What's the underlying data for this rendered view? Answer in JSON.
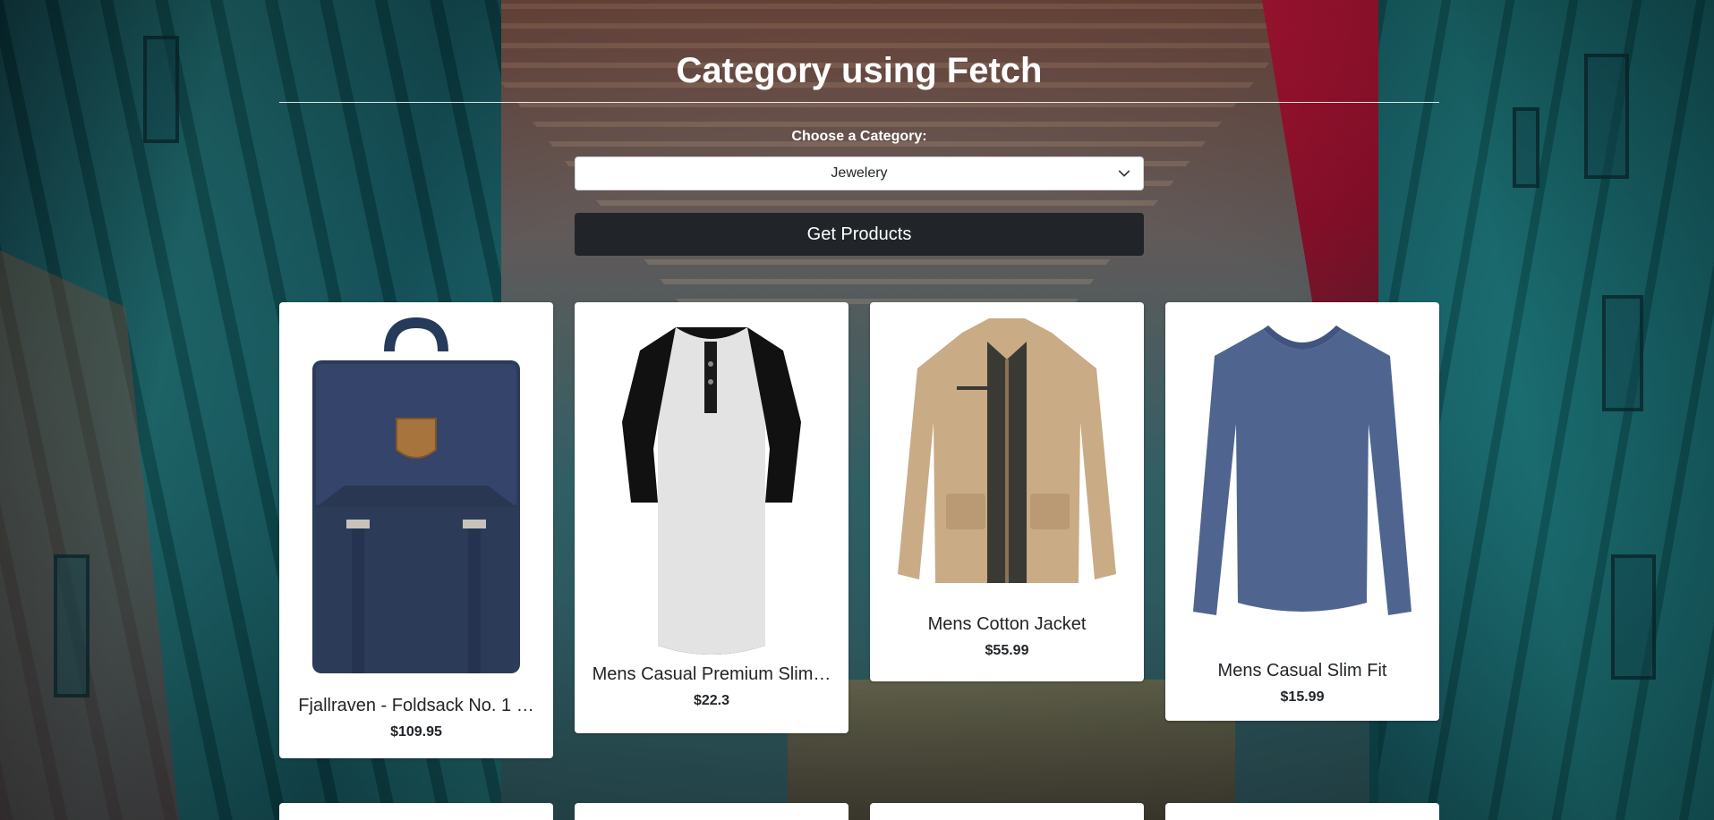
{
  "page": {
    "title": "Category using Fetch"
  },
  "form": {
    "category_label": "Choose a Category:",
    "selected_category": "Jewelery",
    "button_label": "Get Products"
  },
  "products": [
    {
      "title": "Fjallraven - Foldsack No. 1 …",
      "price": "$109.95",
      "image": "backpack-image"
    },
    {
      "title": "Mens Casual Premium Slim…",
      "price": "$22.3",
      "image": "raglan-tshirt-image"
    },
    {
      "title": "Mens Cotton Jacket",
      "price": "$55.99",
      "image": "cotton-jacket-image"
    },
    {
      "title": "Mens Casual Slim Fit",
      "price": "$15.99",
      "image": "long-sleeve-tshirt-image"
    }
  ],
  "colors": {
    "button_bg": "#212529",
    "card_bg": "#ffffff",
    "text_dark": "#212529"
  }
}
